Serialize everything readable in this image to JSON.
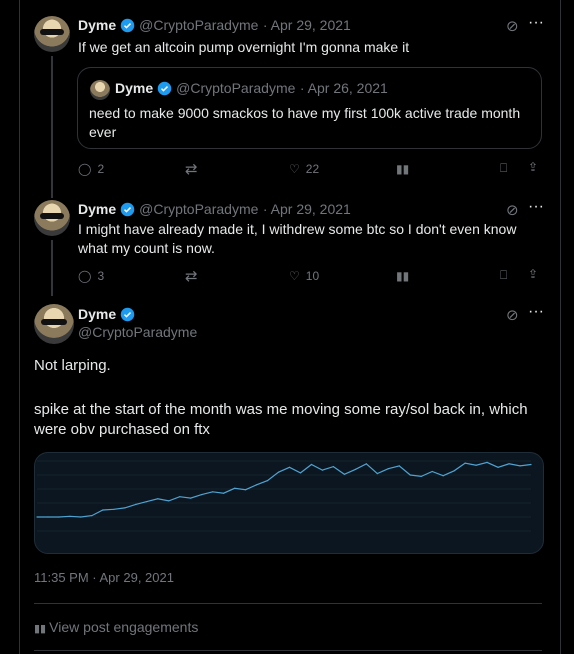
{
  "tweets": [
    {
      "name": "Dyme",
      "handle": "@CryptoParadyme",
      "date": "· Apr 29, 2021",
      "text": "If we get an altcoin pump overnight I'm gonna make it",
      "quote": {
        "name": "Dyme",
        "handle": "@CryptoParadyme",
        "date": "· Apr 26, 2021",
        "text": "need to make 9000 smackos to have my first 100k active trade month ever"
      },
      "actions": {
        "replies": "2",
        "retweets": "",
        "likes": "22"
      }
    },
    {
      "name": "Dyme",
      "handle": "@CryptoParadyme",
      "date": "· Apr 29, 2021",
      "text": "I might have already made it, I withdrew some btc so I don't even know what my count is now.",
      "actions": {
        "replies": "3",
        "retweets": "",
        "likes": "10"
      }
    }
  ],
  "main": {
    "name": "Dyme",
    "handle": "@CryptoParadyme",
    "line1": "Not larping.",
    "line2": "spike at the start of the month was me moving some ray/sol back in, which were obv purchased on ftx",
    "timestamp": "11:35 PM · Apr 29, 2021",
    "engagements": "View post engagements"
  },
  "colors": {
    "background": "#000000",
    "text": "#e7e9ea",
    "muted": "#71767b",
    "verified": "#1d9bf0",
    "chart_line": "#4fa3d1",
    "chart_bg": "#0b1620"
  },
  "chart_data": {
    "type": "line",
    "title": "",
    "xlabel": "",
    "ylabel": "",
    "series": [
      {
        "values": [
          2,
          2,
          2,
          2.1,
          2,
          2.2,
          3,
          3.1,
          3.3,
          3.8,
          4.2,
          4.6,
          4.3,
          4.9,
          4.7,
          5.2,
          5.6,
          5.4,
          6.1,
          5.9,
          6.6,
          7.2,
          8.4,
          9.1,
          8.3,
          9.5,
          8.7,
          9.2,
          8.1,
          8.8,
          9.6,
          8.2,
          8.9,
          9.3,
          8.0,
          7.8,
          8.5,
          7.9,
          8.6,
          9.7,
          9.4,
          9.8,
          9.1,
          9.6,
          9.3,
          9.5
        ]
      }
    ]
  }
}
